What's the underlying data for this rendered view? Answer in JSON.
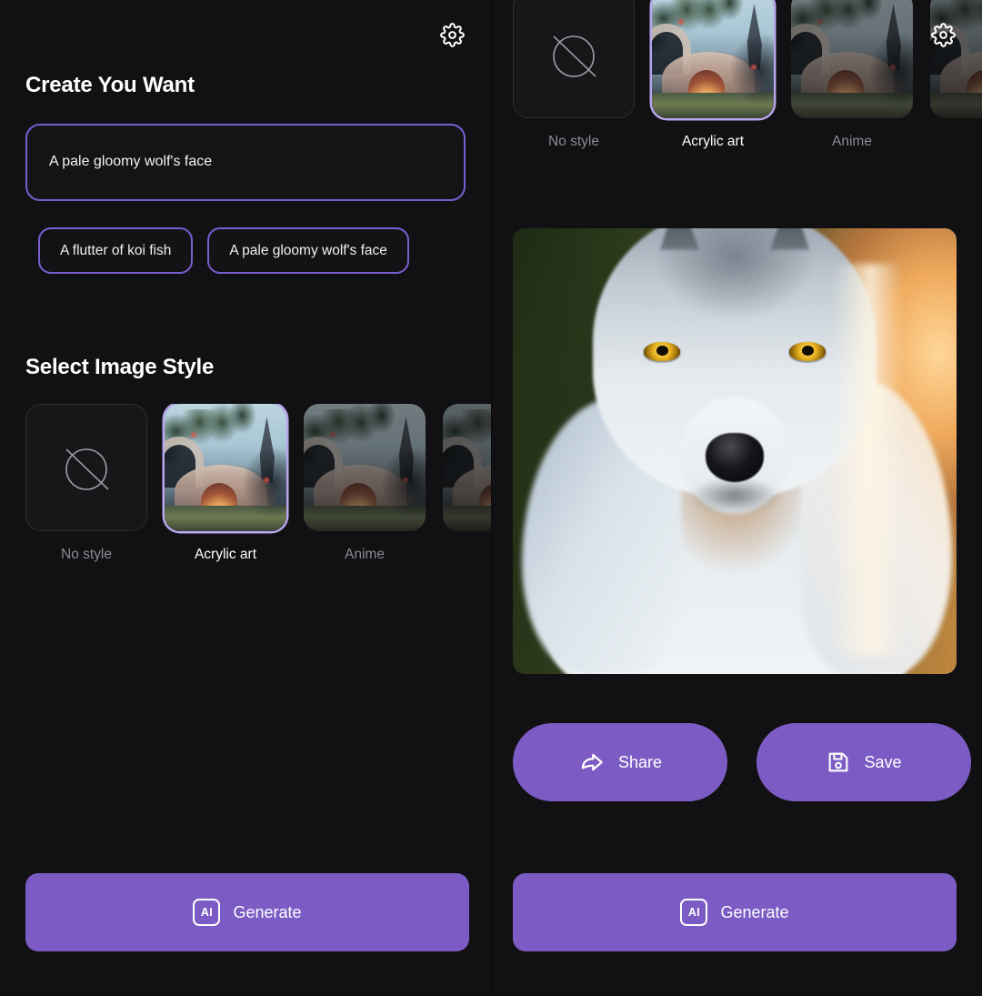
{
  "app": {
    "background_color": "#0d0d0f",
    "panel_color": "#111113",
    "accent_color": "#7c5cc4",
    "accent_border_color": "#7a5ed0",
    "selected_ring_color": "#b9a6ef"
  },
  "left_panel": {
    "settings_icon": "gear-icon",
    "create_section": {
      "title": "Create You Want",
      "prompt_value": "A pale gloomy wolf's face",
      "prompt_placeholder": "A pale gloomy wolf's face",
      "suggestions": [
        {
          "label": "A flutter of koi fish"
        },
        {
          "label": "A pale gloomy wolf's face"
        }
      ]
    },
    "style_section": {
      "title": "Select Image Style",
      "styles": [
        {
          "label": "No style",
          "selected": false,
          "icon": "circle-slash-icon"
        },
        {
          "label": "Acrylic art",
          "selected": true,
          "icon": ""
        },
        {
          "label": "Anime",
          "selected": false,
          "icon": ""
        },
        {
          "label": "",
          "selected": false,
          "icon": ""
        }
      ]
    },
    "generate_button": {
      "label": "Generate",
      "badge": "AI"
    }
  },
  "right_panel": {
    "settings_icon": "gear-icon",
    "style_section": {
      "styles": [
        {
          "label": "No style",
          "selected": false,
          "icon": "circle-slash-icon"
        },
        {
          "label": "Acrylic art",
          "selected": true,
          "icon": ""
        },
        {
          "label": "Anime",
          "selected": false,
          "icon": ""
        },
        {
          "label": "",
          "selected": false,
          "icon": ""
        }
      ]
    },
    "result": {
      "alt": "Generated image of a pale wolf's face with yellow eyes"
    },
    "actions": [
      {
        "label": "Share",
        "icon": "share-arrow-icon"
      },
      {
        "label": "Save",
        "icon": "floppy-disk-icon"
      }
    ],
    "generate_button": {
      "label": "Generate",
      "badge": "AI"
    }
  }
}
